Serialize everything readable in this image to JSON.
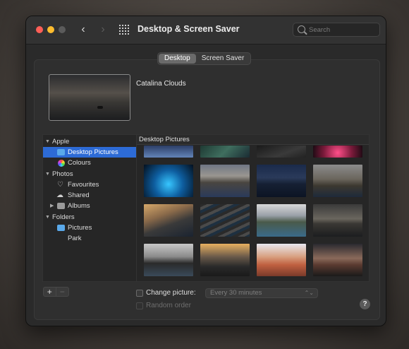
{
  "window": {
    "title": "Desktop & Screen Saver"
  },
  "search": {
    "placeholder": "Search"
  },
  "tabs": [
    {
      "label": "Desktop",
      "active": true
    },
    {
      "label": "Screen Saver",
      "active": false
    }
  ],
  "current_wallpaper": "Catalina Clouds",
  "sidebar": {
    "sections": [
      {
        "label": "Apple",
        "items": [
          {
            "label": "Desktop Pictures",
            "selected": true,
            "icon": "folder-icon"
          },
          {
            "label": "Colours",
            "icon": "colours-icon"
          }
        ]
      },
      {
        "label": "Photos",
        "items": [
          {
            "label": "Favourites",
            "icon": "heart-icon"
          },
          {
            "label": "Shared",
            "icon": "cloud-icon"
          },
          {
            "label": "Albums",
            "icon": "folder-icon",
            "collapsed": true
          }
        ]
      },
      {
        "label": "Folders",
        "items": [
          {
            "label": "Pictures",
            "icon": "folder-icon"
          },
          {
            "label": "Park"
          }
        ]
      }
    ]
  },
  "grid": {
    "header": "Desktop Pictures"
  },
  "controls": {
    "add_label": "+",
    "remove_label": "−",
    "change_picture_label": "Change picture:",
    "change_picture_checked": false,
    "interval_value": "Every 30 minutes",
    "random_order_label": "Random order",
    "random_order_checked": false,
    "help_label": "?"
  }
}
